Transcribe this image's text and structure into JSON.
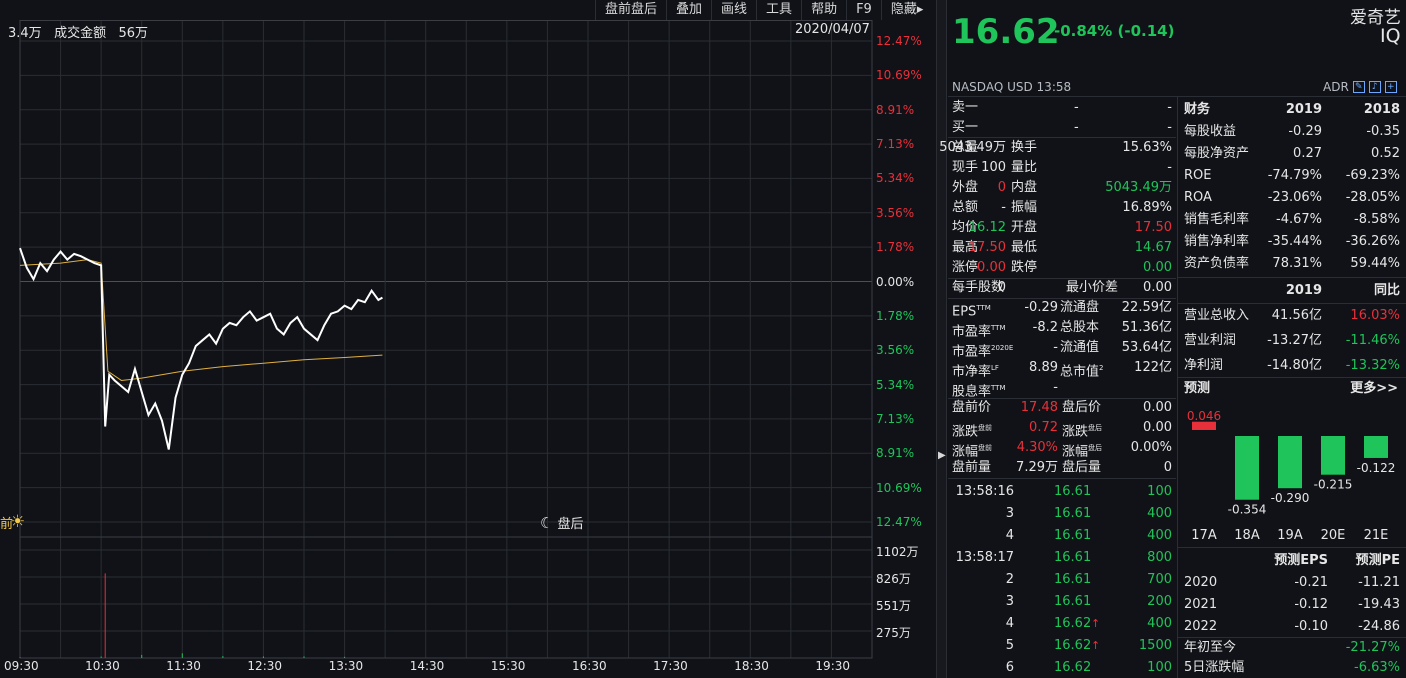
{
  "toolbar": [
    "盘前盘后",
    "叠加",
    "画线",
    "工具",
    "帮助",
    "F9",
    "隐藏▸"
  ],
  "chart_header": {
    "volume": "3.4万",
    "amount_label": "成交金额",
    "amount": "56万",
    "date": "2020/04/07"
  },
  "pct_axis_top": [
    "12.47%",
    "10.69%",
    "8.91%",
    "7.13%",
    "5.34%",
    "3.56%",
    "1.78%"
  ],
  "pct_axis_zero": "0.00%",
  "pct_axis_bottom": [
    "1.78%",
    "3.56%",
    "5.34%",
    "7.13%",
    "8.91%",
    "10.69%",
    "12.47%"
  ],
  "vol_axis": [
    "1102万",
    "826万",
    "551万",
    "275万"
  ],
  "time_axis": [
    "09:30",
    "10:30",
    "11:30",
    "12:30",
    "13:30",
    "14:30",
    "15:30",
    "16:30",
    "17:30",
    "18:30",
    "19:30"
  ],
  "session": {
    "pre_label": "前",
    "after_label": "盘后"
  },
  "chart_data": {
    "type": "line",
    "series": [
      {
        "x": [
          "09:30",
          "09:35",
          "09:40",
          "09:45",
          "09:50",
          "09:55",
          "10:00",
          "10:05",
          "10:10",
          "10:15",
          "10:20",
          "10:25",
          "10:30",
          "10:33",
          "10:36",
          "10:40",
          "10:45",
          "10:50",
          "10:55",
          "11:00",
          "11:05",
          "11:10",
          "11:15",
          "11:20",
          "11:25",
          "11:30",
          "11:35",
          "11:40",
          "11:45",
          "11:50",
          "11:55",
          "12:00",
          "12:05",
          "12:10",
          "12:15",
          "12:20",
          "12:25",
          "12:30",
          "12:35",
          "12:40",
          "12:45",
          "12:50",
          "12:55",
          "13:00",
          "13:05",
          "13:10",
          "13:15",
          "13:20",
          "13:25",
          "13:30",
          "13:35",
          "13:40",
          "13:45",
          "13:50",
          "13:55",
          "13:58"
        ],
        "values": [
          17.05,
          16.88,
          16.78,
          16.92,
          16.85,
          16.95,
          17.02,
          16.95,
          17.0,
          16.98,
          16.95,
          16.92,
          16.9,
          15.5,
          15.95,
          15.9,
          15.85,
          15.8,
          16.0,
          15.8,
          15.6,
          15.7,
          15.55,
          15.3,
          15.75,
          15.95,
          16.05,
          16.2,
          16.25,
          16.3,
          16.22,
          16.35,
          16.4,
          16.38,
          16.45,
          16.5,
          16.42,
          16.45,
          16.48,
          16.35,
          16.3,
          16.4,
          16.45,
          16.35,
          16.3,
          16.25,
          16.38,
          16.48,
          16.5,
          16.55,
          16.52,
          16.6,
          16.58,
          16.68,
          16.6,
          16.62
        ]
      },
      {
        "x": [
          "09:30",
          "10:00",
          "10:20",
          "10:30",
          "10:35",
          "10:45",
          "11:00",
          "11:30",
          "12:00",
          "12:30",
          "13:00",
          "13:30",
          "13:58"
        ],
        "values": [
          16.9,
          16.92,
          16.95,
          16.92,
          15.98,
          15.9,
          15.92,
          15.98,
          16.02,
          16.05,
          16.08,
          16.1,
          16.12
        ]
      }
    ],
    "volume_bars": {
      "x": [
        "09:30",
        "10:30",
        "10:33",
        "11:00",
        "11:30",
        "12:00",
        "12:30",
        "13:00",
        "13:30"
      ],
      "values": [
        10,
        20,
        1080,
        40,
        60,
        25,
        20,
        20,
        15
      ]
    },
    "prev_close": 16.76,
    "pct_range": [
      -12.47,
      12.47
    ],
    "vol_range": [
      0,
      1378
    ],
    "x_range": [
      "09:30",
      "20:00"
    ]
  },
  "quote": {
    "price": "16.62",
    "change": "-0.84% (-0.14)",
    "name": "爱奇艺",
    "ticker": "IQ",
    "exchange": "NASDAQ   USD   13:58",
    "adr": "ADR"
  },
  "orderbook": [
    {
      "label": "卖一",
      "price": "-",
      "vol": "-"
    },
    {
      "label": "买一",
      "price": "-",
      "vol": "-"
    }
  ],
  "stats": [
    {
      "l1": "总量",
      "v1": "5043.49万",
      "c1": "white",
      "l2": "换手",
      "v2": "15.63%",
      "c2": "white"
    },
    {
      "l1": "现手",
      "v1": "100",
      "c1": "white",
      "l2": "量比",
      "v2": "-",
      "c2": "white"
    },
    {
      "l1": "外盘",
      "v1": "0",
      "c1": "red",
      "l2": "内盘",
      "v2": "5043.49万",
      "c2": "green"
    },
    {
      "l1": "总额",
      "v1": "-",
      "c1": "white",
      "l2": "振幅",
      "v2": "16.89%",
      "c2": "white"
    },
    {
      "l1": "均价",
      "v1": "16.12",
      "c1": "green",
      "l2": "开盘",
      "v2": "17.50",
      "c2": "red"
    },
    {
      "l1": "最高",
      "v1": "17.50",
      "c1": "red",
      "l2": "最低",
      "v2": "14.67",
      "c2": "green"
    },
    {
      "l1": "涨停",
      "v1": "0.00",
      "c1": "red",
      "l2": "跌停",
      "v2": "0.00",
      "c2": "green"
    }
  ],
  "lot": {
    "l1": "每手股数",
    "v1": "0",
    "l2": "最小价差",
    "v2": "0.00"
  },
  "valuation": [
    {
      "l1": "EPS",
      "s1": "TTM",
      "v1": "-0.29",
      "l2": "流通盘",
      "s2": "",
      "v2": "22.59亿"
    },
    {
      "l1": "市盈率",
      "s1": "TTM",
      "v1": "-8.2",
      "l2": "总股本",
      "s2": "",
      "v2": "51.36亿"
    },
    {
      "l1": "市盈率",
      "s1": "2020E",
      "v1": "-",
      "l2": "流通值",
      "s2": "",
      "v2": "53.64亿"
    },
    {
      "l1": "市净率",
      "s1": "LF",
      "v1": "8.89",
      "l2": "总市值",
      "s2": "2",
      "v2": "122亿"
    },
    {
      "l1": "股息率",
      "s1": "TTM",
      "v1": "-",
      "l2": "",
      "s2": "",
      "v2": ""
    }
  ],
  "prepost": [
    {
      "l1": "盘前价",
      "s1": "",
      "v1": "17.48",
      "c1": "red",
      "l2": "盘后价",
      "s2": "",
      "v2": "0.00",
      "c2": "white"
    },
    {
      "l1": "涨跌",
      "s1": "盘前",
      "v1": "0.72",
      "c1": "red",
      "l2": "涨跌",
      "s2": "盘后",
      "v2": "0.00",
      "c2": "white"
    },
    {
      "l1": "涨幅",
      "s1": "盘前",
      "v1": "4.30%",
      "c1": "red",
      "l2": "涨幅",
      "s2": "盘后",
      "v2": "0.00%",
      "c2": "white"
    },
    {
      "l1": "盘前量",
      "s1": "",
      "v1": "7.29万",
      "c1": "white",
      "l2": "盘后量",
      "s2": "",
      "v2": "0",
      "c2": "white"
    }
  ],
  "ticks": [
    {
      "time": "13:58:16",
      "price": "16.61",
      "vol": "100",
      "up": false
    },
    {
      "time": "3",
      "price": "16.61",
      "vol": "400",
      "up": false
    },
    {
      "time": "4",
      "price": "16.61",
      "vol": "400",
      "up": false
    },
    {
      "time": "13:58:17",
      "price": "16.61",
      "vol": "800",
      "up": false
    },
    {
      "time": "2",
      "price": "16.61",
      "vol": "700",
      "up": false
    },
    {
      "time": "3",
      "price": "16.61",
      "vol": "200",
      "up": false
    },
    {
      "time": "4",
      "price": "16.62",
      "vol": "400",
      "up": true
    },
    {
      "time": "5",
      "price": "16.62",
      "vol": "1500",
      "up": true
    },
    {
      "time": "6",
      "price": "16.62",
      "vol": "100",
      "up": false
    }
  ],
  "finance": {
    "header": [
      "财务",
      "2019",
      "2018"
    ],
    "rows": [
      {
        "label": "每股收益",
        "a": "-0.29",
        "b": "-0.35"
      },
      {
        "label": "每股净资产",
        "a": "0.27",
        "b": "0.52"
      },
      {
        "label": "ROE",
        "a": "-74.79%",
        "b": "-69.23%"
      },
      {
        "label": "ROA",
        "a": "-23.06%",
        "b": "-28.05%"
      },
      {
        "label": "销售毛利率",
        "a": "-4.67%",
        "b": "-8.58%"
      },
      {
        "label": "销售净利率",
        "a": "-35.44%",
        "b": "-36.26%"
      },
      {
        "label": "资产负债率",
        "a": "78.31%",
        "b": "59.44%"
      }
    ],
    "header2": [
      "",
      "2019",
      "同比"
    ],
    "rows2": [
      {
        "label": "营业总收入",
        "a": "41.56亿",
        "b": "16.03%",
        "bc": "red"
      },
      {
        "label": "营业利润",
        "a": "-13.27亿",
        "b": "-11.46%",
        "bc": "green"
      },
      {
        "label": "净利润",
        "a": "-14.80亿",
        "b": "-13.32%",
        "bc": "green"
      }
    ]
  },
  "forecast": {
    "title": "预测",
    "more": "更多>>",
    "bars": [
      {
        "label": "17A",
        "value": 0.046,
        "text": "0.046"
      },
      {
        "label": "18A",
        "value": -0.354,
        "text": "-0.354"
      },
      {
        "label": "19A",
        "value": -0.29,
        "text": "-0.290"
      },
      {
        "label": "20E",
        "value": -0.215,
        "text": "-0.215"
      },
      {
        "label": "21E",
        "value": -0.122,
        "text": "-0.122"
      }
    ],
    "table_header": [
      "",
      "预测EPS",
      "预测PE"
    ],
    "rows": [
      {
        "year": "2020",
        "eps": "-0.21",
        "pe": "-11.21"
      },
      {
        "year": "2021",
        "eps": "-0.12",
        "pe": "-19.43"
      },
      {
        "year": "2022",
        "eps": "-0.10",
        "pe": "-24.86"
      }
    ],
    "ytd_label": "年初至今",
    "ytd": "-21.27%",
    "d5_label": "5日涨跌幅",
    "d5": "-6.63%"
  }
}
